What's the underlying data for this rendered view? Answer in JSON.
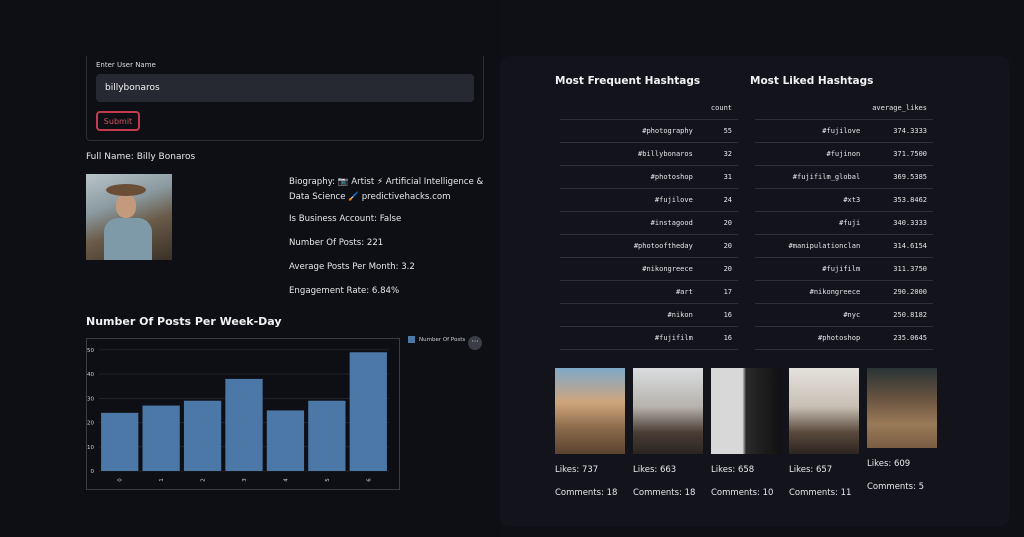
{
  "form": {
    "label": "Enter User Name",
    "value": "billybonaros",
    "submit_label": "Submit"
  },
  "profile": {
    "full_name": "Full Name: Billy Bonaros",
    "bio_line1": "Biography: 📷 Artist ⚡ Artificial Intelligence &",
    "bio_line2": "Data Science 🖌️ predictivehacks.com",
    "business": "Is Business Account: False",
    "posts": "Number Of Posts: 221",
    "avg_posts": "Average Posts Per Month: 3.2",
    "engagement": "Engagement Rate: 6.84%"
  },
  "chart_title": "Number Of Posts Per Week-Day",
  "chart_data": {
    "type": "bar",
    "categories": [
      "0",
      "1",
      "2",
      "3",
      "4",
      "5",
      "6"
    ],
    "series": [
      {
        "name": "Number Of Posts",
        "values": [
          24,
          27,
          29,
          38,
          25,
          29,
          49
        ]
      }
    ],
    "ylim": [
      0,
      52
    ],
    "yticks": [
      "0",
      "10",
      "20",
      "30",
      "40",
      "50"
    ],
    "bar_color": "#4c78a8",
    "legend": "top-right",
    "grid": true
  },
  "hashtags_frequent": {
    "title": "Most Frequent Hashtags",
    "col_header": "count",
    "rows": [
      [
        "#photography",
        "55"
      ],
      [
        "#billybonaros",
        "32"
      ],
      [
        "#photoshop",
        "31"
      ],
      [
        "#fujilove",
        "24"
      ],
      [
        "#instagood",
        "20"
      ],
      [
        "#photooftheday",
        "20"
      ],
      [
        "#nikongreece",
        "20"
      ],
      [
        "#art",
        "17"
      ],
      [
        "#nikon",
        "16"
      ],
      [
        "#fujifilm",
        "16"
      ]
    ]
  },
  "hashtags_liked": {
    "title": "Most Liked Hashtags",
    "col_header": "average_likes",
    "rows": [
      [
        "#fujilove",
        "374.3333"
      ],
      [
        "#fujinon",
        "371.7500"
      ],
      [
        "#fujifilm_global",
        "369.5385"
      ],
      [
        "#xt3",
        "353.8462"
      ],
      [
        "#fuji",
        "340.3333"
      ],
      [
        "#manipulationclan",
        "314.6154"
      ],
      [
        "#fujifilm",
        "311.3750"
      ],
      [
        "#nikongreece",
        "290.2000"
      ],
      [
        "#nyc",
        "250.8182"
      ],
      [
        "#photoshop",
        "235.0645"
      ]
    ]
  },
  "top_posts": [
    {
      "likes": "Likes: 737",
      "comments": "Comments: 18"
    },
    {
      "likes": "Likes: 663",
      "comments": "Comments: 18"
    },
    {
      "likes": "Likes: 658",
      "comments": "Comments: 10"
    },
    {
      "likes": "Likes: 657",
      "comments": "Comments: 11"
    },
    {
      "likes": "Likes: 609",
      "comments": "Comments: 5"
    }
  ],
  "colors": {
    "accent": "#c43a4e",
    "bar": "#4c78a8",
    "background": "#0f1015"
  },
  "icons": {
    "menu": "more-dots-icon"
  }
}
